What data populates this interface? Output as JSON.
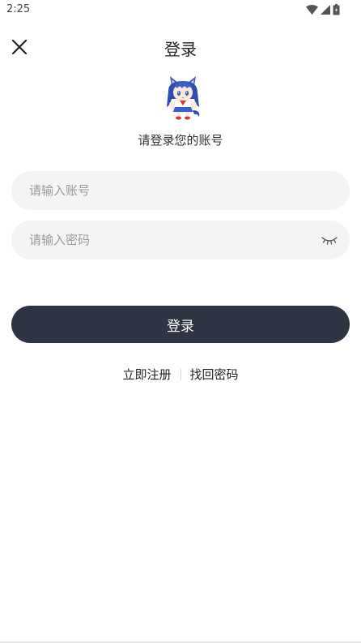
{
  "status_bar": {
    "time": "2:25",
    "icons": [
      "wifi-icon",
      "signal-icon",
      "battery-icon"
    ]
  },
  "header": {
    "title": "登录",
    "close_icon": "close-icon"
  },
  "hero": {
    "avatar": "anime-cat-girl-avatar",
    "subtitle": "请登录您的账号"
  },
  "form": {
    "account_placeholder": "请输入账号",
    "account_value": "",
    "password_placeholder": "请输入密码",
    "password_value": "",
    "eye_icon": "eye-closed-icon",
    "login_label": "登录"
  },
  "links": {
    "register": "立即注册",
    "recover": "找回密码"
  },
  "colors": {
    "button_bg": "#2f3442",
    "field_bg": "#f4f4f5",
    "placeholder": "#9a9a9e",
    "avatar_hair": "#3a5fc7"
  }
}
